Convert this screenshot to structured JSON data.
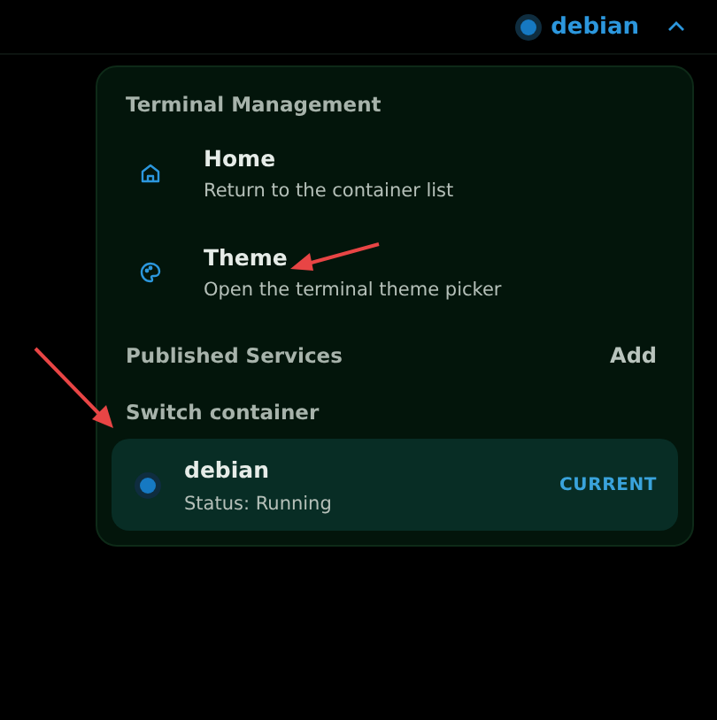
{
  "container_switcher": {
    "label": "debian",
    "expanded": true
  },
  "menu": {
    "title": "Terminal Management",
    "items": [
      {
        "kind": "home",
        "title": "Home",
        "description": "Return to the container list"
      },
      {
        "kind": "theme",
        "title": "Theme",
        "description": "Open the terminal theme picker"
      }
    ],
    "published_services": {
      "title": "Published Services",
      "action": "Add"
    },
    "switch_container": {
      "title": "Switch container",
      "containers": [
        {
          "name": "debian",
          "status": "Status: Running",
          "selected": true,
          "badge": "CURRENT"
        }
      ]
    }
  }
}
